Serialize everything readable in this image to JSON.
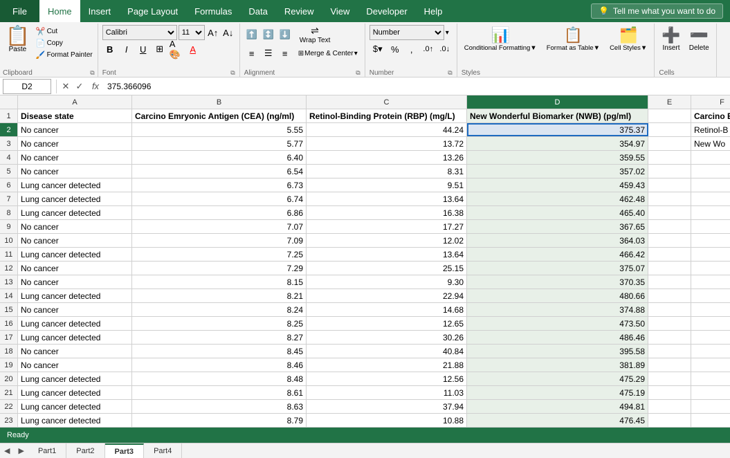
{
  "menu": {
    "file": "File",
    "tabs": [
      "Home",
      "Insert",
      "Page Layout",
      "Formulas",
      "Data",
      "Review",
      "View",
      "Developer",
      "Help"
    ],
    "tell_me": "Tell me what you want to do"
  },
  "ribbon": {
    "clipboard_label": "Clipboard",
    "font_label": "Font",
    "alignment_label": "Alignment",
    "number_label": "Number",
    "styles_label": "Styles",
    "cells_label": "Cells",
    "paste_label": "Paste",
    "cut_label": "Cut",
    "copy_label": "Copy",
    "format_painter_label": "Format Painter",
    "font_name": "Calibri",
    "font_size": "11",
    "bold": "B",
    "italic": "I",
    "underline": "U",
    "wrap_text": "Wrap Text",
    "merge_center": "Merge & Center",
    "number_format": "Number",
    "percent": "%",
    "comma": ",",
    "conditional_format": "Conditional Formatting▼",
    "format_as_table": "Format as Table▼",
    "cell_styles": "Cell Styles▼",
    "insert_btn": "Insert",
    "delete_btn": "Delete"
  },
  "formula_bar": {
    "cell_ref": "D2",
    "formula": "375.366096"
  },
  "columns": {
    "row_num_width": 26,
    "headers": [
      "A",
      "B",
      "C",
      "D",
      "E",
      "F"
    ],
    "widths": [
      165,
      252,
      232,
      262,
      62,
      90
    ]
  },
  "col_headers_display": [
    "",
    "A",
    "B",
    "C",
    "D",
    "E",
    "F"
  ],
  "rows": [
    {
      "num": 1,
      "cells": [
        "Disease state",
        "Carcino Emryonic Antigen (CEA) (ng/ml)",
        "Retinol-Binding Protein (RBP) (mg/L)",
        "New Wonderful Biomarker (NWB) (pg/ml)",
        "",
        "Carcino E"
      ]
    },
    {
      "num": 2,
      "cells": [
        "No cancer",
        "",
        "44.24",
        "375.37",
        "",
        "Retinol-B"
      ],
      "b_val": "5.55",
      "selected": true
    },
    {
      "num": 3,
      "cells": [
        "No cancer",
        "",
        "13.72",
        "354.97",
        "",
        "New Wo"
      ],
      "b_val": "5.77"
    },
    {
      "num": 4,
      "cells": [
        "No cancer",
        "",
        "13.26",
        "359.55",
        "",
        ""
      ],
      "b_val": "6.40"
    },
    {
      "num": 5,
      "cells": [
        "No cancer",
        "",
        "8.31",
        "357.02",
        "",
        ""
      ],
      "b_val": "6.54"
    },
    {
      "num": 6,
      "cells": [
        "Lung cancer detected",
        "",
        "9.51",
        "459.43",
        "",
        ""
      ],
      "b_val": "6.73"
    },
    {
      "num": 7,
      "cells": [
        "Lung cancer detected",
        "",
        "13.64",
        "462.48",
        "",
        ""
      ],
      "b_val": "6.74"
    },
    {
      "num": 8,
      "cells": [
        "Lung cancer detected",
        "",
        "16.38",
        "465.40",
        "",
        ""
      ],
      "b_val": "6.86"
    },
    {
      "num": 9,
      "cells": [
        "No cancer",
        "",
        "17.27",
        "367.65",
        "",
        ""
      ],
      "b_val": "7.07"
    },
    {
      "num": 10,
      "cells": [
        "No cancer",
        "",
        "12.02",
        "364.03",
        "",
        ""
      ],
      "b_val": "7.09"
    },
    {
      "num": 11,
      "cells": [
        "Lung cancer detected",
        "",
        "13.64",
        "466.42",
        "",
        ""
      ],
      "b_val": "7.25"
    },
    {
      "num": 12,
      "cells": [
        "No cancer",
        "",
        "25.15",
        "375.07",
        "",
        ""
      ],
      "b_val": "7.29"
    },
    {
      "num": 13,
      "cells": [
        "No cancer",
        "",
        "9.30",
        "370.35",
        "",
        ""
      ],
      "b_val": "8.15"
    },
    {
      "num": 14,
      "cells": [
        "Lung cancer detected",
        "",
        "22.94",
        "480.66",
        "",
        ""
      ],
      "b_val": "8.21"
    },
    {
      "num": 15,
      "cells": [
        "No cancer",
        "",
        "14.68",
        "374.88",
        "",
        ""
      ],
      "b_val": "8.24"
    },
    {
      "num": 16,
      "cells": [
        "Lung cancer detected",
        "",
        "12.65",
        "473.50",
        "",
        ""
      ],
      "b_val": "8.25"
    },
    {
      "num": 17,
      "cells": [
        "Lung cancer detected",
        "",
        "30.26",
        "486.46",
        "",
        ""
      ],
      "b_val": "8.27"
    },
    {
      "num": 18,
      "cells": [
        "No cancer",
        "",
        "40.84",
        "395.58",
        "",
        ""
      ],
      "b_val": "8.45"
    },
    {
      "num": 19,
      "cells": [
        "No cancer",
        "",
        "21.88",
        "381.89",
        "",
        ""
      ],
      "b_val": "8.46"
    },
    {
      "num": 20,
      "cells": [
        "Lung cancer detected",
        "",
        "12.56",
        "475.29",
        "",
        ""
      ],
      "b_val": "8.48"
    },
    {
      "num": 21,
      "cells": [
        "Lung cancer detected",
        "",
        "11.03",
        "475.19",
        "",
        ""
      ],
      "b_val": "8.61"
    },
    {
      "num": 22,
      "cells": [
        "Lung cancer detected",
        "",
        "37.94",
        "494.81",
        "",
        ""
      ],
      "b_val": "8.63"
    },
    {
      "num": 23,
      "cells": [
        "Lung cancer detected",
        "",
        "10.88",
        "476.45",
        "",
        ""
      ],
      "b_val": "8.79"
    }
  ],
  "sheet_tabs": [
    "Part1",
    "Part2",
    "Part3",
    "Part4"
  ],
  "active_tab": 2,
  "status": {
    "ready": "Ready"
  }
}
